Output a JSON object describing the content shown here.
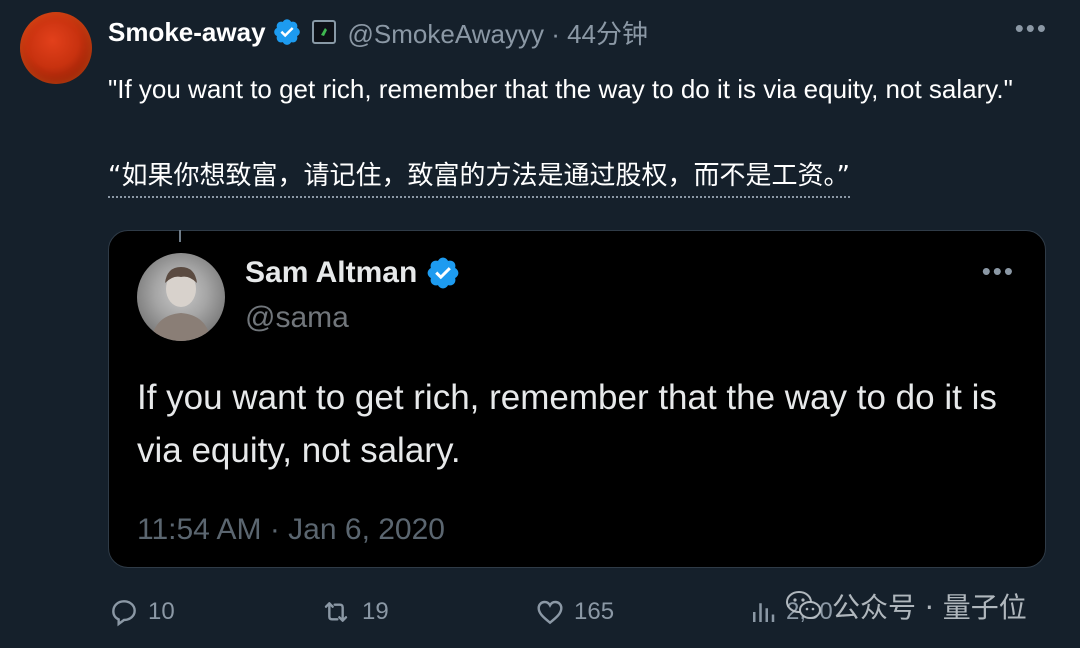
{
  "tweet": {
    "display_name": "Smoke-away",
    "handle": "@SmokeAwayyy",
    "time": "· 44分钟",
    "more": "•••",
    "text": "\"If you want to get rich, remember that the way to do it is via equity, not salary.\"",
    "translation": "“如果你想致富，请记住，致富的方法是通过股权，而不是工资。”"
  },
  "quote": {
    "display_name": "Sam Altman",
    "handle": "@sama",
    "more": "•••",
    "text": "If you want to get rich, remember that the way to do it is via equity, not salary.",
    "timestamp": "11:54 AM · Jan 6, 2020"
  },
  "actions": {
    "replies": "10",
    "retweets": "19",
    "likes": "165",
    "views": "2,60"
  },
  "watermark": {
    "text": "公众号 · 量子位"
  },
  "colors": {
    "background": "#15202b",
    "quote_background": "#000000",
    "verified_blue": "#1d9bf0",
    "muted_text": "#8b98a5"
  },
  "icons": [
    "verified-badge-icon",
    "square-badge-icon",
    "more-icon",
    "reply-icon",
    "retweet-icon",
    "like-icon",
    "views-icon",
    "wechat-icon"
  ]
}
